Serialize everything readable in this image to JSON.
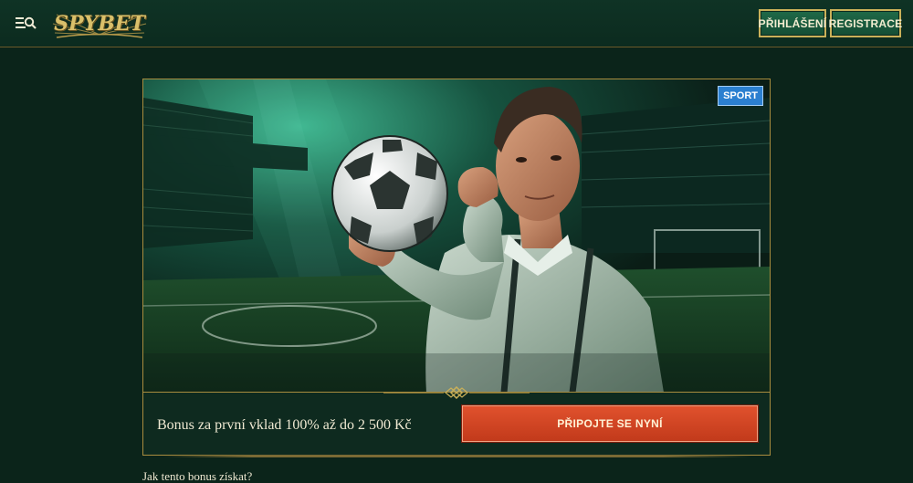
{
  "header": {
    "logo_text": "SPYBET",
    "login_label": "PŘIHLÁŠENÍ",
    "register_label": "REGISTRACE",
    "menu_icon": "menu-search-icon"
  },
  "promo": {
    "badge": "SPORT",
    "offer_text": "Bonus za první vklad 100% až do 2 500 Kč",
    "cta_label": "PŘIPOJTE SE NYNÍ"
  },
  "content": {
    "question": "Jak tento bonus získat?"
  },
  "colors": {
    "background": "#0b241a",
    "gold_border": "#c9b059",
    "cta": "#d64526",
    "badge": "#2b7fd0",
    "header_button": "#1b5e40"
  }
}
